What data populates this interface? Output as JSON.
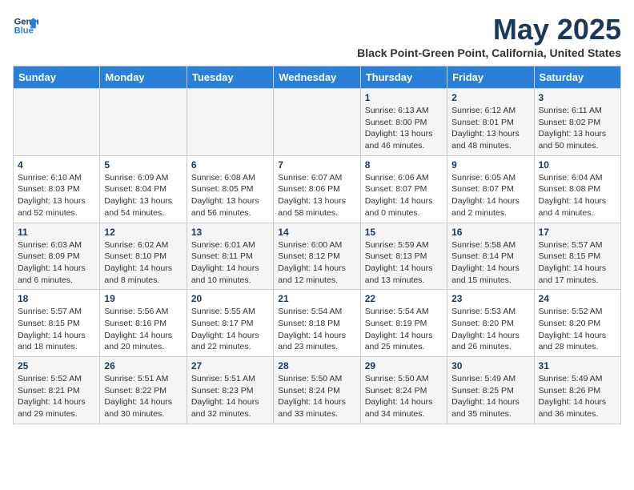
{
  "logo": {
    "line1": "General",
    "line2": "Blue"
  },
  "title": "May 2025",
  "subtitle": "Black Point-Green Point, California, United States",
  "weekdays": [
    "Sunday",
    "Monday",
    "Tuesday",
    "Wednesday",
    "Thursday",
    "Friday",
    "Saturday"
  ],
  "weeks": [
    [
      {
        "day": "",
        "info": ""
      },
      {
        "day": "",
        "info": ""
      },
      {
        "day": "",
        "info": ""
      },
      {
        "day": "",
        "info": ""
      },
      {
        "day": "1",
        "info": "Sunrise: 6:13 AM\nSunset: 8:00 PM\nDaylight: 13 hours\nand 46 minutes."
      },
      {
        "day": "2",
        "info": "Sunrise: 6:12 AM\nSunset: 8:01 PM\nDaylight: 13 hours\nand 48 minutes."
      },
      {
        "day": "3",
        "info": "Sunrise: 6:11 AM\nSunset: 8:02 PM\nDaylight: 13 hours\nand 50 minutes."
      }
    ],
    [
      {
        "day": "4",
        "info": "Sunrise: 6:10 AM\nSunset: 8:03 PM\nDaylight: 13 hours\nand 52 minutes."
      },
      {
        "day": "5",
        "info": "Sunrise: 6:09 AM\nSunset: 8:04 PM\nDaylight: 13 hours\nand 54 minutes."
      },
      {
        "day": "6",
        "info": "Sunrise: 6:08 AM\nSunset: 8:05 PM\nDaylight: 13 hours\nand 56 minutes."
      },
      {
        "day": "7",
        "info": "Sunrise: 6:07 AM\nSunset: 8:06 PM\nDaylight: 13 hours\nand 58 minutes."
      },
      {
        "day": "8",
        "info": "Sunrise: 6:06 AM\nSunset: 8:07 PM\nDaylight: 14 hours\nand 0 minutes."
      },
      {
        "day": "9",
        "info": "Sunrise: 6:05 AM\nSunset: 8:07 PM\nDaylight: 14 hours\nand 2 minutes."
      },
      {
        "day": "10",
        "info": "Sunrise: 6:04 AM\nSunset: 8:08 PM\nDaylight: 14 hours\nand 4 minutes."
      }
    ],
    [
      {
        "day": "11",
        "info": "Sunrise: 6:03 AM\nSunset: 8:09 PM\nDaylight: 14 hours\nand 6 minutes."
      },
      {
        "day": "12",
        "info": "Sunrise: 6:02 AM\nSunset: 8:10 PM\nDaylight: 14 hours\nand 8 minutes."
      },
      {
        "day": "13",
        "info": "Sunrise: 6:01 AM\nSunset: 8:11 PM\nDaylight: 14 hours\nand 10 minutes."
      },
      {
        "day": "14",
        "info": "Sunrise: 6:00 AM\nSunset: 8:12 PM\nDaylight: 14 hours\nand 12 minutes."
      },
      {
        "day": "15",
        "info": "Sunrise: 5:59 AM\nSunset: 8:13 PM\nDaylight: 14 hours\nand 13 minutes."
      },
      {
        "day": "16",
        "info": "Sunrise: 5:58 AM\nSunset: 8:14 PM\nDaylight: 14 hours\nand 15 minutes."
      },
      {
        "day": "17",
        "info": "Sunrise: 5:57 AM\nSunset: 8:15 PM\nDaylight: 14 hours\nand 17 minutes."
      }
    ],
    [
      {
        "day": "18",
        "info": "Sunrise: 5:57 AM\nSunset: 8:15 PM\nDaylight: 14 hours\nand 18 minutes."
      },
      {
        "day": "19",
        "info": "Sunrise: 5:56 AM\nSunset: 8:16 PM\nDaylight: 14 hours\nand 20 minutes."
      },
      {
        "day": "20",
        "info": "Sunrise: 5:55 AM\nSunset: 8:17 PM\nDaylight: 14 hours\nand 22 minutes."
      },
      {
        "day": "21",
        "info": "Sunrise: 5:54 AM\nSunset: 8:18 PM\nDaylight: 14 hours\nand 23 minutes."
      },
      {
        "day": "22",
        "info": "Sunrise: 5:54 AM\nSunset: 8:19 PM\nDaylight: 14 hours\nand 25 minutes."
      },
      {
        "day": "23",
        "info": "Sunrise: 5:53 AM\nSunset: 8:20 PM\nDaylight: 14 hours\nand 26 minutes."
      },
      {
        "day": "24",
        "info": "Sunrise: 5:52 AM\nSunset: 8:20 PM\nDaylight: 14 hours\nand 28 minutes."
      }
    ],
    [
      {
        "day": "25",
        "info": "Sunrise: 5:52 AM\nSunset: 8:21 PM\nDaylight: 14 hours\nand 29 minutes."
      },
      {
        "day": "26",
        "info": "Sunrise: 5:51 AM\nSunset: 8:22 PM\nDaylight: 14 hours\nand 30 minutes."
      },
      {
        "day": "27",
        "info": "Sunrise: 5:51 AM\nSunset: 8:23 PM\nDaylight: 14 hours\nand 32 minutes."
      },
      {
        "day": "28",
        "info": "Sunrise: 5:50 AM\nSunset: 8:24 PM\nDaylight: 14 hours\nand 33 minutes."
      },
      {
        "day": "29",
        "info": "Sunrise: 5:50 AM\nSunset: 8:24 PM\nDaylight: 14 hours\nand 34 minutes."
      },
      {
        "day": "30",
        "info": "Sunrise: 5:49 AM\nSunset: 8:25 PM\nDaylight: 14 hours\nand 35 minutes."
      },
      {
        "day": "31",
        "info": "Sunrise: 5:49 AM\nSunset: 8:26 PM\nDaylight: 14 hours\nand 36 minutes."
      }
    ]
  ]
}
